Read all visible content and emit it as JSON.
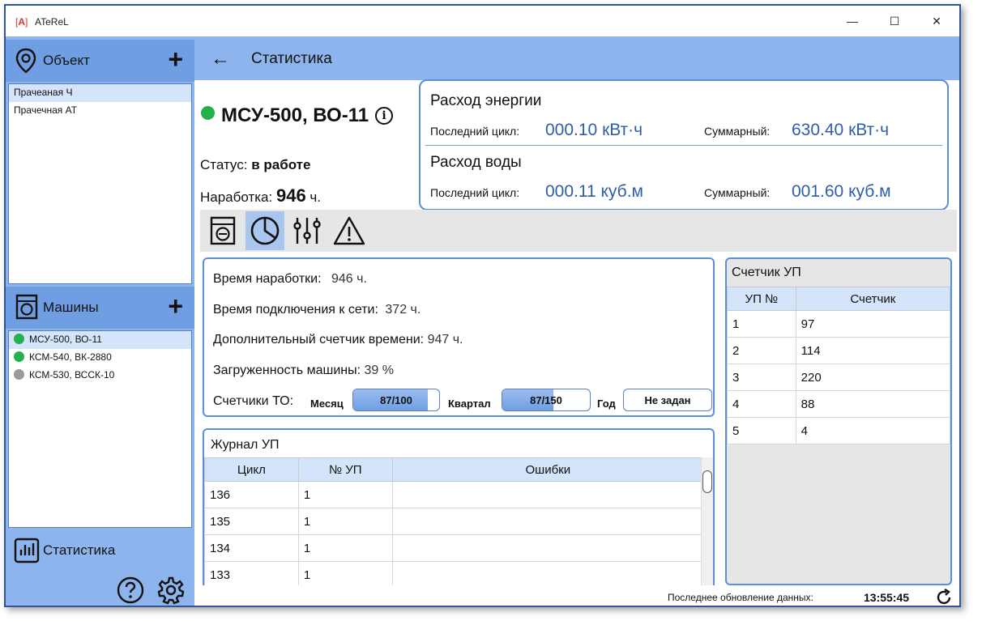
{
  "window": {
    "app_name": "ATeReL",
    "logo_text": "A",
    "controls": {
      "minimize": "—",
      "maximize": "☐",
      "close": "✕"
    }
  },
  "sidebar": {
    "objects_header": {
      "label": "Объект",
      "add": "+"
    },
    "objects": [
      {
        "label": "Прачеаная Ч",
        "selected": true
      },
      {
        "label": "Прачечная АТ",
        "selected": false
      }
    ],
    "machines_header": {
      "label": "Машины",
      "add": "+"
    },
    "machines": [
      {
        "label": "МСУ-500, ВО-11",
        "status_color": "#22b14c",
        "selected": true
      },
      {
        "label": "КСМ-540, ВК-2880",
        "status_color": "#22b14c",
        "selected": false
      },
      {
        "label": "КСМ-530, ВССК-10",
        "status_color": "#9a9a9a",
        "selected": false
      }
    ],
    "stats_nav": {
      "label": "Статистика"
    }
  },
  "header": {
    "back": "←",
    "title": "Статистика"
  },
  "machine": {
    "name": "МСУ-500, ВО-11",
    "info": "i",
    "status_label": "Статус:",
    "status_value": "в работе",
    "runtime_label": "Наработка:",
    "runtime_value": "946",
    "runtime_unit": "ч."
  },
  "energy": {
    "title": "Расход энергии",
    "last_label": "Последний цикл:",
    "last_value": "000.10 кВт·ч",
    "total_label": "Суммарный:",
    "total_value": "630.40 кВт·ч"
  },
  "water": {
    "title": "Расход воды",
    "last_label": "Последний цикл:",
    "last_value": "000.11 куб.м",
    "total_label": "Суммарный:",
    "total_value": "001.60 куб.м"
  },
  "metrics": {
    "runtime_label": "Время наработки:",
    "runtime_value": "946",
    "runtime_unit": "ч.",
    "network_label": "Время подключения к сети:",
    "network_value": "372 ч.",
    "extra_label": "Дополнительный счетчик времени:",
    "extra_value": "947 ч.",
    "load_label": "Загруженность машины:",
    "load_value": "39 %",
    "to_label": "Счетчики ТО:",
    "month_label": "Месяц",
    "month_value": "87/100",
    "month_fraction": 0.87,
    "quarter_label": "Квартал",
    "quarter_value": "87/150",
    "quarter_fraction": 0.58,
    "year_label": "Год",
    "year_value": "Не задан",
    "year_fraction": 0
  },
  "journal": {
    "title": "Журнал УП",
    "columns": [
      "Цикл",
      "№ УП",
      "Ошибки"
    ],
    "rows": [
      [
        "136",
        "1",
        ""
      ],
      [
        "135",
        "1",
        ""
      ],
      [
        "134",
        "1",
        ""
      ],
      [
        "133",
        "1",
        ""
      ]
    ]
  },
  "counter": {
    "title": "Счетчик УП",
    "columns": [
      "УП №",
      "Счетчик"
    ],
    "rows": [
      [
        "1",
        "97"
      ],
      [
        "2",
        "114"
      ],
      [
        "3",
        "220"
      ],
      [
        "4",
        "88"
      ],
      [
        "5",
        "4"
      ]
    ]
  },
  "statusbar": {
    "label": "Последнее обновление данных:",
    "time": "13:55:45"
  }
}
